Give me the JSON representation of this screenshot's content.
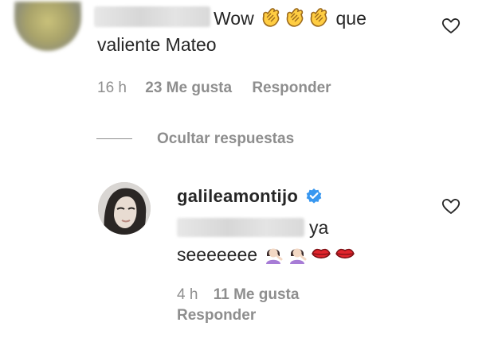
{
  "comment1": {
    "text_start": "Wow",
    "text_end": "que",
    "text_line2": "valiente Mateo",
    "emoji_icons": [
      "clapping-hands-icon",
      "clapping-hands-icon",
      "clapping-hands-icon"
    ],
    "time": "16 h",
    "likes": "23 Me gusta",
    "reply_label": "Responder"
  },
  "hide_replies_label": "Ocultar respuestas",
  "reply": {
    "username": "galileamontijo",
    "verified_icon": "verified-badge-icon",
    "text_suffix": "ya",
    "text_line2": "seeeeeee",
    "emoji_icons": [
      "woman-facepalming-icon",
      "woman-facepalming-icon",
      "lips-icon",
      "lips-icon"
    ],
    "time": "4 h",
    "likes": "11 Me gusta",
    "reply_label": "Responder"
  },
  "colors": {
    "text": "#262626",
    "meta": "#8e8e8e",
    "verified": "#3897f0",
    "lips": "#e0242c"
  }
}
